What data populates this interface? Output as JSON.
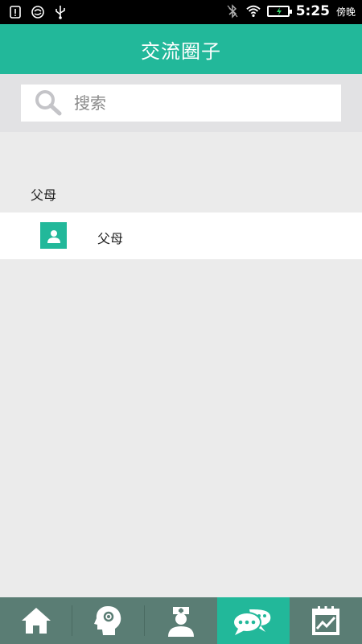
{
  "status_bar": {
    "time": "5:25",
    "period": "傍晚",
    "left_icons": [
      "notification-icon",
      "sync-icon",
      "usb-icon"
    ],
    "right_icons": [
      "bluetooth-off-icon",
      "wifi-icon",
      "battery-charging-icon"
    ]
  },
  "header": {
    "title": "交流圈子"
  },
  "search": {
    "placeholder": "搜索",
    "value": ""
  },
  "section": {
    "title": "父母",
    "items": [
      {
        "label": "父母",
        "icon": "user-icon"
      }
    ]
  },
  "tabs": [
    {
      "icon": "home-icon",
      "active": false
    },
    {
      "icon": "head-profile-icon",
      "active": false
    },
    {
      "icon": "nurse-icon",
      "active": false
    },
    {
      "icon": "chat-bubbles-icon",
      "active": true
    },
    {
      "icon": "chart-checklist-icon",
      "active": false
    }
  ],
  "colors": {
    "accent": "#22b89a",
    "tabbar": "#5a7d74",
    "background": "#ebebeb"
  }
}
